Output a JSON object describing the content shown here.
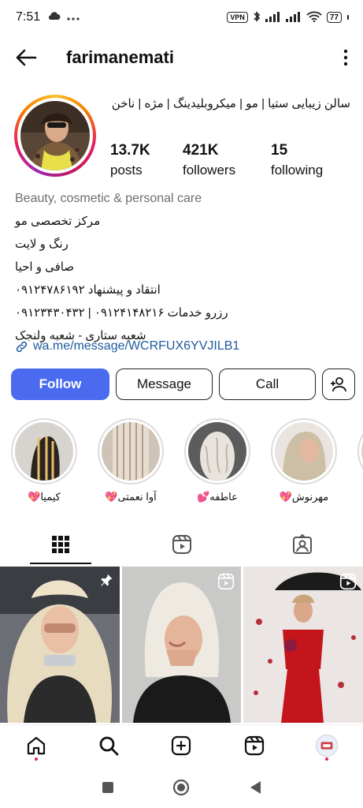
{
  "status_bar": {
    "time": "7:51",
    "vpn": "VPN",
    "battery": "77",
    "icons": [
      "cloud-icon",
      "more-dots-icon",
      "bluetooth-icon",
      "signal-icon",
      "signal-icon",
      "wifi-icon"
    ]
  },
  "header": {
    "username": "farimanemati"
  },
  "profile": {
    "full_name": "سالن زیبایی ستیا | مو | میکروبلیدینگ | مژه | ناخن",
    "stats": [
      {
        "value": "13.7K",
        "label": "posts"
      },
      {
        "value": "421K",
        "label": "followers"
      },
      {
        "value": "15",
        "label": "following"
      }
    ],
    "category": "Beauty, cosmetic & personal care",
    "bio_lines": [
      "مرکز تخصصی مو",
      "رنگ و لایت",
      "صافی و احیا",
      "انتقاد و پیشنهاد ۰۹۱۲۴۷۸۶۱۹۲",
      "رزرو خدمات ۰۹۱۲۴۱۴۸۲۱۶ | ۰۹۱۲۳۴۳۰۴۳۲",
      "شعبه ستاری - شعبه ولنجک"
    ],
    "link": "wa.me/message/WCRFUX6YVJILB1"
  },
  "actions": {
    "follow": "Follow",
    "message": "Message",
    "call": "Call"
  },
  "highlights": [
    {
      "label": "کیمیا💖"
    },
    {
      "label": "آوا نعمتی💖"
    },
    {
      "label": "عاطفه💕"
    },
    {
      "label": "مهرنوش💖"
    }
  ],
  "tabs": [
    "grid-icon",
    "reels-icon",
    "tagged-icon"
  ],
  "nav": [
    "home-icon",
    "search-icon",
    "create-icon",
    "reels-icon",
    "profile-avatar"
  ],
  "colors": {
    "accent": "#4a6af0",
    "link": "#1f5a9e",
    "category": "#6e6e6e"
  }
}
